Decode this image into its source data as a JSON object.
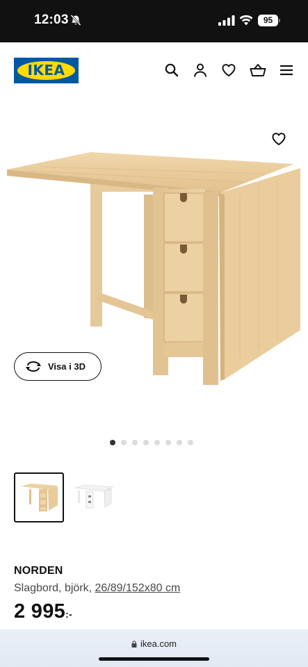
{
  "status_bar": {
    "time": "12:03",
    "battery": "95",
    "icons": [
      "bell-slash-icon",
      "signal-icon",
      "wifi-icon",
      "battery-icon"
    ]
  },
  "header": {
    "logo_text": "IKEA",
    "brand_colors": {
      "blue": "#0058A3",
      "yellow": "#FFDB00"
    },
    "icons": [
      "search-icon",
      "account-icon",
      "heart-icon",
      "basket-icon",
      "menu-icon"
    ]
  },
  "gallery": {
    "view_3d_label": "Visa i 3D",
    "image_count": 8,
    "active_index": 0,
    "thumbnails": [
      "birch-table-thumbnail",
      "white-table-thumbnail"
    ],
    "selected_thumbnail": 0
  },
  "product": {
    "name": "NORDEN",
    "description_prefix": "Slagbord, björk,",
    "dimensions": "26/89/152x80 cm",
    "price": "2 995",
    "price_suffix": ":-"
  },
  "browser": {
    "url": "ikea.com"
  }
}
